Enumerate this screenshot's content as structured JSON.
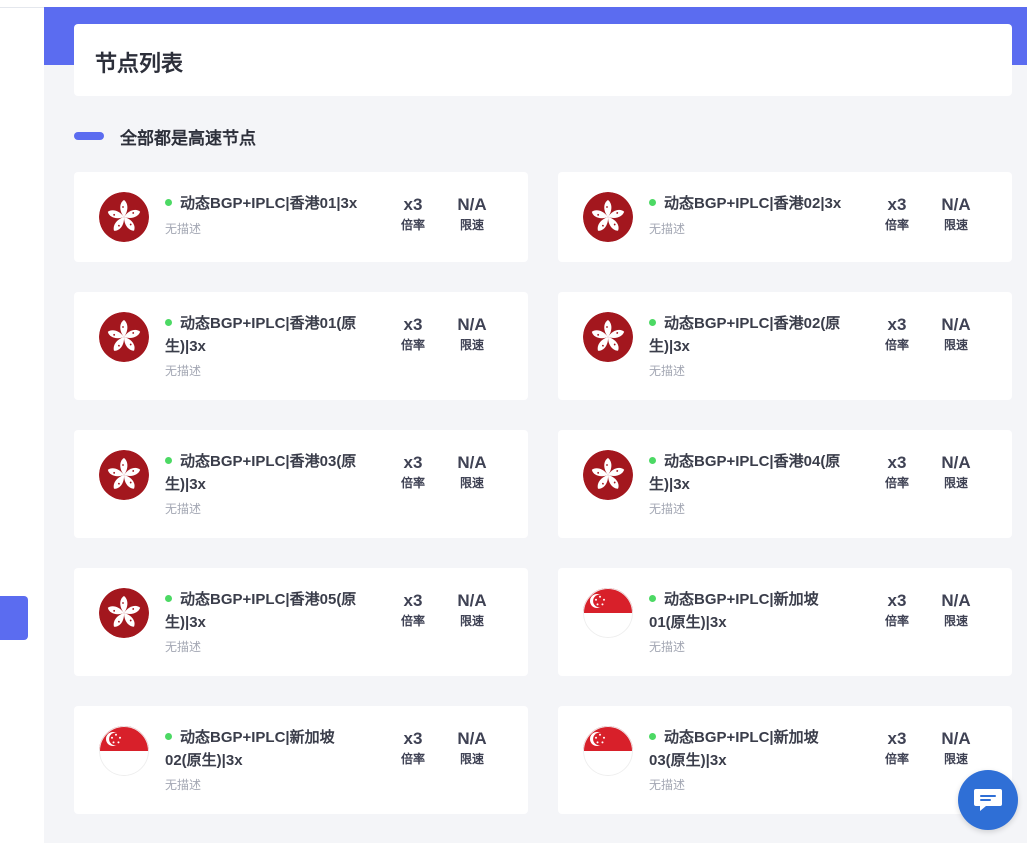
{
  "page": {
    "title": "节点列表",
    "section_title": "全部都是高速节点"
  },
  "colors": {
    "accent": "#5b6cf0",
    "status_online": "#4cd964",
    "hk_red": "#a3171e",
    "sg_red": "#d8202a",
    "chat": "#2f6fd6"
  },
  "nodes": [
    {
      "name": "动态BGP+IPLC|香港01|3x",
      "desc": "无描述",
      "flag": "hong-kong-flag-icon",
      "rate_value": "x3",
      "rate_label": "倍率",
      "limit_value": "N/A",
      "limit_label": "限速"
    },
    {
      "name": "动态BGP+IPLC|香港02|3x",
      "desc": "无描述",
      "flag": "hong-kong-flag-icon",
      "rate_value": "x3",
      "rate_label": "倍率",
      "limit_value": "N/A",
      "limit_label": "限速"
    },
    {
      "name": "动态BGP+IPLC|香港01(原生)|3x",
      "desc": "无描述",
      "flag": "hong-kong-flag-icon",
      "rate_value": "x3",
      "rate_label": "倍率",
      "limit_value": "N/A",
      "limit_label": "限速"
    },
    {
      "name": "动态BGP+IPLC|香港02(原生)|3x",
      "desc": "无描述",
      "flag": "hong-kong-flag-icon",
      "rate_value": "x3",
      "rate_label": "倍率",
      "limit_value": "N/A",
      "limit_label": "限速"
    },
    {
      "name": "动态BGP+IPLC|香港03(原生)|3x",
      "desc": "无描述",
      "flag": "hong-kong-flag-icon",
      "rate_value": "x3",
      "rate_label": "倍率",
      "limit_value": "N/A",
      "limit_label": "限速"
    },
    {
      "name": "动态BGP+IPLC|香港04(原生)|3x",
      "desc": "无描述",
      "flag": "hong-kong-flag-icon",
      "rate_value": "x3",
      "rate_label": "倍率",
      "limit_value": "N/A",
      "limit_label": "限速"
    },
    {
      "name": "动态BGP+IPLC|香港05(原生)|3x",
      "desc": "无描述",
      "flag": "hong-kong-flag-icon",
      "rate_value": "x3",
      "rate_label": "倍率",
      "limit_value": "N/A",
      "limit_label": "限速"
    },
    {
      "name": "动态BGP+IPLC|新加坡01(原生)|3x",
      "desc": "无描述",
      "flag": "singapore-flag-icon",
      "rate_value": "x3",
      "rate_label": "倍率",
      "limit_value": "N/A",
      "limit_label": "限速"
    },
    {
      "name": "动态BGP+IPLC|新加坡02(原生)|3x",
      "desc": "无描述",
      "flag": "singapore-flag-icon",
      "rate_value": "x3",
      "rate_label": "倍率",
      "limit_value": "N/A",
      "limit_label": "限速"
    },
    {
      "name": "动态BGP+IPLC|新加坡03(原生)|3x",
      "desc": "无描述",
      "flag": "singapore-flag-icon",
      "rate_value": "x3",
      "rate_label": "倍率",
      "limit_value": "N/A",
      "limit_label": "限速"
    }
  ],
  "chat": {
    "icon": "chat-bubble-icon"
  }
}
